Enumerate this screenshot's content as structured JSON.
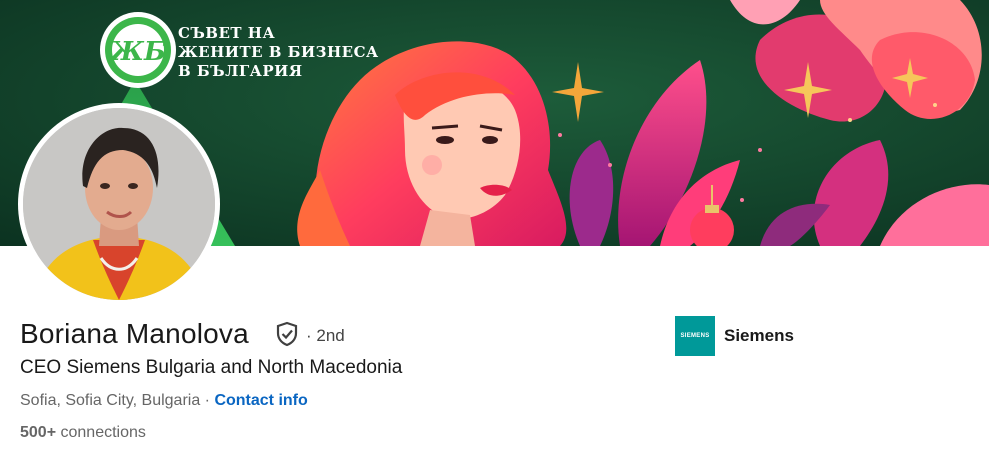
{
  "banner": {
    "logo_mark": "ЖБ",
    "title_lines": [
      "СЪВЕТ НА",
      "ЖЕНИТЕ В БИЗНЕСА",
      "В БЪЛГАРИЯ"
    ]
  },
  "profile": {
    "name": "Boriana Manolova",
    "verified_icon": "shield-check-icon",
    "degree": "· 2nd",
    "headline": "CEO Siemens Bulgaria and North Macedonia",
    "location": "Sofia, Sofia City, Bulgaria",
    "location_separator": " · ",
    "contact_info": "Contact info",
    "connections_count": "500+",
    "connections_label": "connections"
  },
  "company": {
    "logo_text": "SIEMENS",
    "name": "Siemens",
    "logo_color": "#009999"
  },
  "colors": {
    "link": "#0a66c2",
    "text_primary": "#191919",
    "text_secondary": "#666666"
  }
}
